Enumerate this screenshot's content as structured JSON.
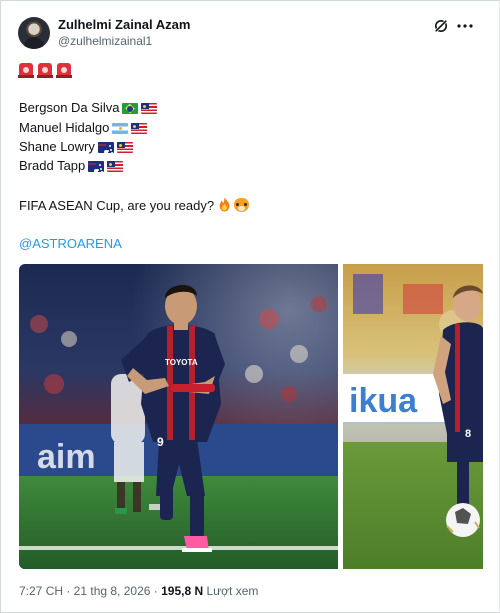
{
  "author": {
    "name": "Zulhelmi Zainal Azam",
    "handle": "@zulhelmizainal1"
  },
  "header_icons": [
    "grok-icon",
    "more-icon"
  ],
  "post": {
    "siren_icons": [
      "siren-icon",
      "siren-icon",
      "siren-icon"
    ],
    "players": [
      {
        "name": "Bergson Da Silva",
        "flags": [
          "flag-brazil",
          "flag-malaysia"
        ]
      },
      {
        "name": "Manuel Hidalgo",
        "flags": [
          "flag-argentina",
          "flag-malaysia"
        ]
      },
      {
        "name": "Shane Lowry",
        "flags": [
          "flag-australia",
          "flag-malaysia"
        ]
      },
      {
        "name": "Bradd Tapp",
        "flags": [
          "flag-australia",
          "flag-malaysia"
        ]
      }
    ],
    "question": "FIFA ASEAN Cup, are you ready?",
    "question_emojis": [
      "fire-icon",
      "tiger-face-icon"
    ],
    "mention": "@ASTROARENA"
  },
  "media": {
    "photo1_jersey_sponsor": "TOYOTA",
    "photo1_jersey_number": "9",
    "photo1_board_text": "aim",
    "photo2_board_text": "ikua",
    "photo2_jersey_number": "8"
  },
  "meta": {
    "time_date": "7:27 CH · 21 thg 8, 2026 · ",
    "views_count": "195,8 N",
    "views_label": " Lượt xem"
  },
  "colors": {
    "link": "#1d9bf0",
    "secondary_text": "#536471",
    "primary_text": "#0f1419",
    "kit_navy": "#1b2550",
    "kit_red": "#b3202e",
    "pitch_green": "#2f7a35"
  }
}
